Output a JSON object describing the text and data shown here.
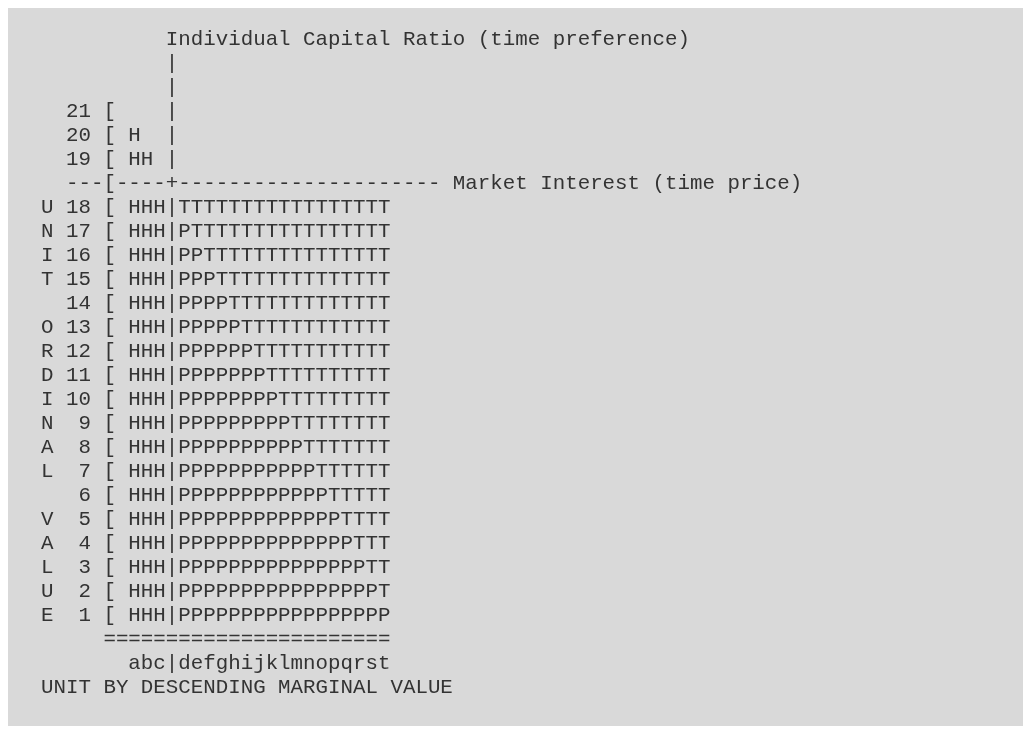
{
  "lines": [
    "          Individual Capital Ratio (time preference)",
    "          |",
    "          |",
    "  21 [    |",
    "  20 [ H  |",
    "  19 [ HH |",
    "  ---[----+--------------------- Market Interest (time price)",
    "U 18 [ HHH|TTTTTTTTTTTTTTTTT",
    "N 17 [ HHH|PTTTTTTTTTTTTTTTT",
    "I 16 [ HHH|PPTTTTTTTTTTTTTTT",
    "T 15 [ HHH|PPPTTTTTTTTTTTTTT",
    "  14 [ HHH|PPPPTTTTTTTTTTTTT",
    "O 13 [ HHH|PPPPPTTTTTTTTTTTT",
    "R 12 [ HHH|PPPPPPTTTTTTTTTTT",
    "D 11 [ HHH|PPPPPPPTTTTTTTTTT",
    "I 10 [ HHH|PPPPPPPPTTTTTTTTT",
    "N  9 [ HHH|PPPPPPPPPTTTTTTTT",
    "A  8 [ HHH|PPPPPPPPPPTTTTTTT",
    "L  7 [ HHH|PPPPPPPPPPPTTTTTT",
    "   6 [ HHH|PPPPPPPPPPPPTTTTT",
    "V  5 [ HHH|PPPPPPPPPPPPPTTTT",
    "A  4 [ HHH|PPPPPPPPPPPPPPTTT",
    "L  3 [ HHH|PPPPPPPPPPPPPPPTT",
    "U  2 [ HHH|PPPPPPPPPPPPPPPPT",
    "E  1 [ HHH|PPPPPPPPPPPPPPPPP",
    "     =======================",
    "       abc|defghijklmnopqrst",
    "UNIT BY DESCENDING MARGINAL VALUE"
  ]
}
